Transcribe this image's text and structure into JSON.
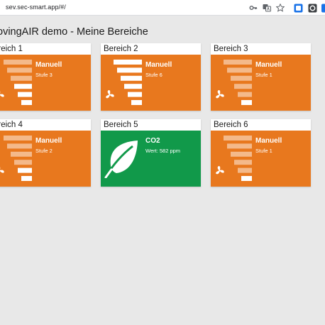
{
  "browser": {
    "url": "sev.sec-smart.app/#/"
  },
  "page": {
    "title": "ovingAIR demo - Meine Bereiche"
  },
  "colors": {
    "orange": "#e8781e",
    "green": "#11994a",
    "bar_active": "#ffffff",
    "bar_inactive": "#f4b98a"
  },
  "tiles": [
    {
      "name": "ereich 1",
      "mode": "Manuell",
      "detail": "Stufe 3",
      "level": 3,
      "levels_total": 6,
      "icon": "fan-icon",
      "status": "orange"
    },
    {
      "name": "Bereich 2",
      "mode": "Manuell",
      "detail": "Stufe 6",
      "level": 6,
      "levels_total": 6,
      "icon": "fan-icon",
      "status": "orange"
    },
    {
      "name": "Bereich 3",
      "mode": "Manuell",
      "detail": "Stufe 1",
      "level": 1,
      "levels_total": 6,
      "icon": "fan-icon",
      "status": "orange"
    },
    {
      "name": "ereich 4",
      "mode": "Manuell",
      "detail": "Stufe 2",
      "level": 2,
      "levels_total": 6,
      "icon": "fan-icon",
      "status": "orange"
    },
    {
      "name": "Bereich 5",
      "mode": "CO2",
      "detail": "Wert: 582 ppm",
      "icon": "leaf-icon",
      "status": "green"
    },
    {
      "name": "Bereich 6",
      "mode": "Manuell",
      "detail": "Stufe 1",
      "level": 1,
      "levels_total": 6,
      "icon": "fan-icon",
      "status": "orange"
    }
  ]
}
